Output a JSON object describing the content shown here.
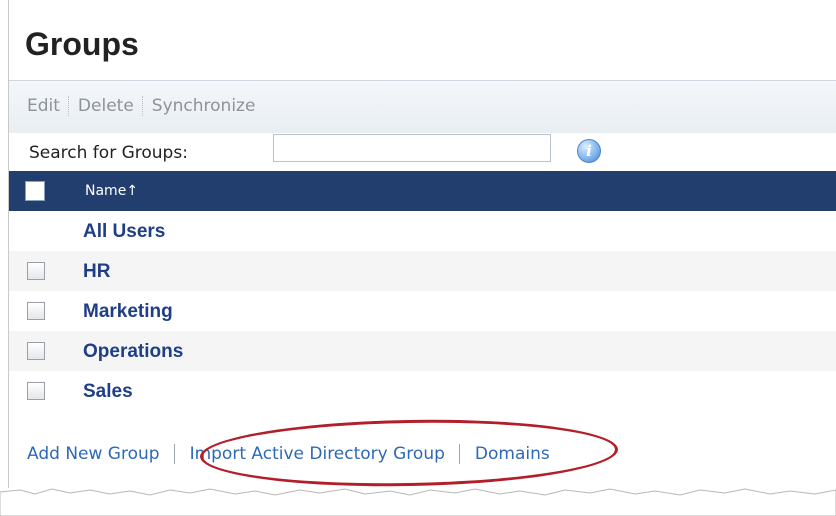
{
  "page": {
    "title": "Groups"
  },
  "toolbar": {
    "actions": [
      "Edit",
      "Delete",
      "Synchronize"
    ]
  },
  "search": {
    "label": "Search for Groups:",
    "value": "",
    "placeholder": "",
    "info_icon": "info-icon"
  },
  "table": {
    "header": {
      "name": "Name",
      "sort_indicator": "↑"
    },
    "rows": [
      {
        "label": "All Users",
        "has_checkbox": false,
        "checked": false
      },
      {
        "label": "HR",
        "has_checkbox": true,
        "checked": false
      },
      {
        "label": "Marketing",
        "has_checkbox": true,
        "checked": false
      },
      {
        "label": "Operations",
        "has_checkbox": true,
        "checked": false
      },
      {
        "label": "Sales",
        "has_checkbox": true,
        "checked": false
      }
    ]
  },
  "footer": {
    "links": [
      "Add New Group",
      "Import Active Directory Group",
      "Domains"
    ]
  },
  "colors": {
    "header_bg": "#223e6e",
    "link": "#2f68b6",
    "row_text": "#1f3e86",
    "highlight_oval": "#b21f2a"
  }
}
